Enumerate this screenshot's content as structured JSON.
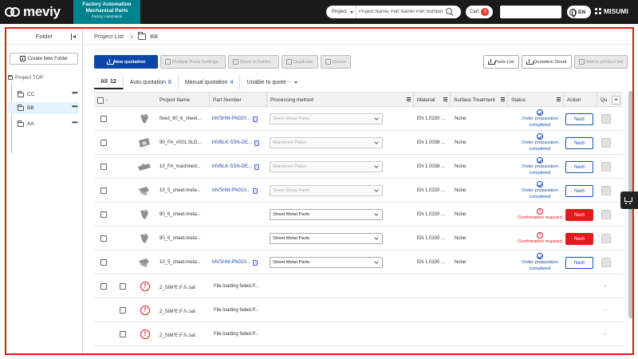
{
  "header": {
    "logo": "meviy",
    "fa_badge": {
      "line1": "Factory Automation",
      "line2": "Mechanical Parts",
      "line3": "Factory Automation"
    },
    "search_scope": "Project",
    "search_placeholder": "Project Name/ Part Name/ Part Number",
    "cart_label": "Cart",
    "cart_count": "3",
    "language": "EN",
    "brand": "MISUMI"
  },
  "sidebar": {
    "title": "Folder",
    "new_folder_label": "Create New Folder",
    "root": "Project TOP",
    "folders": [
      {
        "name": "CC",
        "active": false
      },
      {
        "name": "BB",
        "active": true
      },
      {
        "name": "AA",
        "active": false
      }
    ],
    "more": "•••"
  },
  "breadcrumb": {
    "root": "Project List",
    "current": "BB"
  },
  "toolbar": {
    "new_quotation": "New quotation",
    "multiple_parts_settings": "Multiple Parts Settings",
    "move_to_folder": "Move to Folder",
    "duplicate": "Duplicate",
    "delete": "Delete",
    "parts_list": "Parts List",
    "quotation_sheet": "Quotation Sheet",
    "add_to_product_list": "Add to product list"
  },
  "tabs": [
    {
      "label": "All",
      "count": "12"
    },
    {
      "label": "Auto quotation",
      "count": "8"
    },
    {
      "label": "Manual quotation",
      "count": "4"
    },
    {
      "label": "Unable to quote",
      "count": "-"
    }
  ],
  "columns": {
    "select": "-",
    "project_name": "Project Name",
    "part_number": "Part Number",
    "processing_method": "Processing method",
    "material": "Material",
    "surface_treatment": "Surface Treatment",
    "status": "Status",
    "action": "Action",
    "quantity": "Qu",
    "add": "+"
  },
  "rows": [
    {
      "name": "fixed_90_6_sheet...",
      "part": "MVSHM-PN020...",
      "process": "Sheet Metal Parts",
      "process_active": false,
      "material": "EN 1.0330 ...",
      "surface": "None",
      "status_type": "ok",
      "status": "Order preparation completed",
      "action": "Next",
      "action_red": false
    },
    {
      "name": "90_FA_#001.SLD...",
      "part": "MVBLK-SSN-DE...",
      "process": "Machined Plates",
      "process_active": false,
      "material": "EN 1.0038 ...",
      "surface": "None",
      "status_type": "ok",
      "status": "Order preparation completed",
      "action": "Next",
      "action_red": false
    },
    {
      "name": "10_FA_machined...",
      "part": "MVBLK-SSN-DE...",
      "process": "Machined Plates",
      "process_active": false,
      "material": "EN 1.0038 ...",
      "surface": "None",
      "status_type": "ok",
      "status": "Order preparation completed",
      "action": "Next",
      "action_red": false
    },
    {
      "name": "10_5_sheet-meta...",
      "part": "MVSHM-PN010...",
      "process": "Sheet Metal Parts",
      "process_active": false,
      "material": "EN 1.0330 ...",
      "surface": "None",
      "status_type": "ok",
      "status": "Order preparation completed",
      "action": "Next",
      "action_red": false
    },
    {
      "name": "90_6_sheet-meta...",
      "part": "",
      "process": "Sheet Metal Parts",
      "process_active": true,
      "material": "EN 1.0330 ...",
      "surface": "None",
      "status_type": "warn",
      "status": "Confirmation required",
      "action": "Next",
      "action_red": true
    },
    {
      "name": "90_6_sheet-meta...",
      "part": "",
      "process": "Sheet Metal Parts",
      "process_active": true,
      "material": "EN 1.0330 ...",
      "surface": "None",
      "status_type": "warn",
      "status": "Confirmation required",
      "action": "Next",
      "action_red": true
    },
    {
      "name": "10_5_sheet-meta...",
      "part": "MVSHM-PN010...",
      "process": "Sheet Metal Parts",
      "process_active": true,
      "material": "EN 1.0330 ...",
      "surface": "None",
      "status_type": "ok",
      "status": "Order preparation completed",
      "action": "Next",
      "action_red": false
    }
  ],
  "error_rows": [
    {
      "name": "2_SIMモデル.sat",
      "message": "File loading failed.P...",
      "qty": "-"
    },
    {
      "name": "2_SIMモデル.sat",
      "message": "File loading failed.P...",
      "qty": "-"
    },
    {
      "name": "2_SIMモデル.sat",
      "message": "File loading failed.P...",
      "qty": "-"
    }
  ],
  "colors": {
    "accent": "#0b47a8",
    "fa_teal": "#00838f",
    "error": "#e01b1b",
    "frame": "#e01b1b"
  }
}
